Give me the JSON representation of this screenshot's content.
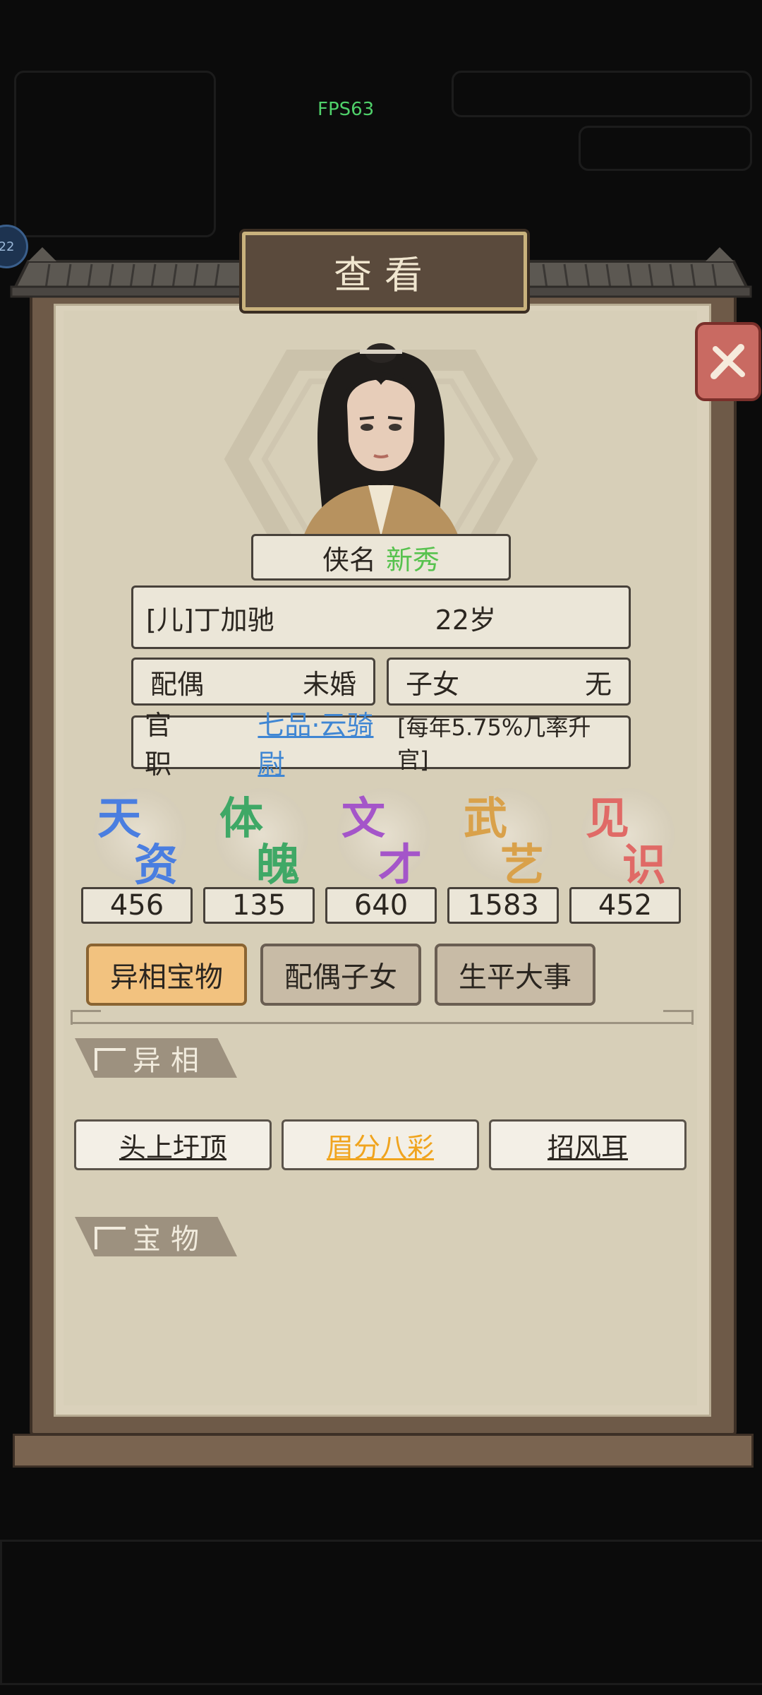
{
  "hud": {
    "fps": "FPS63",
    "side_badge": "22"
  },
  "dialog": {
    "title": "查看"
  },
  "profile": {
    "name_label": "侠名",
    "name_value": "新秀",
    "name_value_color": "#57c24e",
    "identity": "[儿]丁加驰",
    "age": "22岁",
    "spouse_label": "配偶",
    "spouse_value": "未婚",
    "children_label": "子女",
    "children_value": "无",
    "office_label": "官职",
    "office_rank": "七品·云骑尉",
    "office_note": "[每年5.75%几率升官]"
  },
  "attributes": [
    {
      "c1": "天",
      "c2": "资",
      "value": "456",
      "color": "#4a7ee0"
    },
    {
      "c1": "体",
      "c2": "魄",
      "value": "135",
      "color": "#3fa866"
    },
    {
      "c1": "文",
      "c2": "才",
      "value": "640",
      "color": "#a455c9"
    },
    {
      "c1": "武",
      "c2": "艺",
      "value": "1583",
      "color": "#d9a14a"
    },
    {
      "c1": "见",
      "c2": "识",
      "value": "452",
      "color": "#e06a66"
    }
  ],
  "tabs": [
    {
      "label": "异相宝物",
      "active": true
    },
    {
      "label": "配偶子女",
      "active": false
    },
    {
      "label": "生平大事",
      "active": false
    }
  ],
  "sections": {
    "traits_title": "异相",
    "treasures_title": "宝物"
  },
  "traits": [
    {
      "label": "头上圩顶",
      "color": "#2b2620"
    },
    {
      "label": "眉分八彩",
      "color": "#f0a41e"
    },
    {
      "label": "招风耳",
      "color": "#2b2620"
    }
  ]
}
